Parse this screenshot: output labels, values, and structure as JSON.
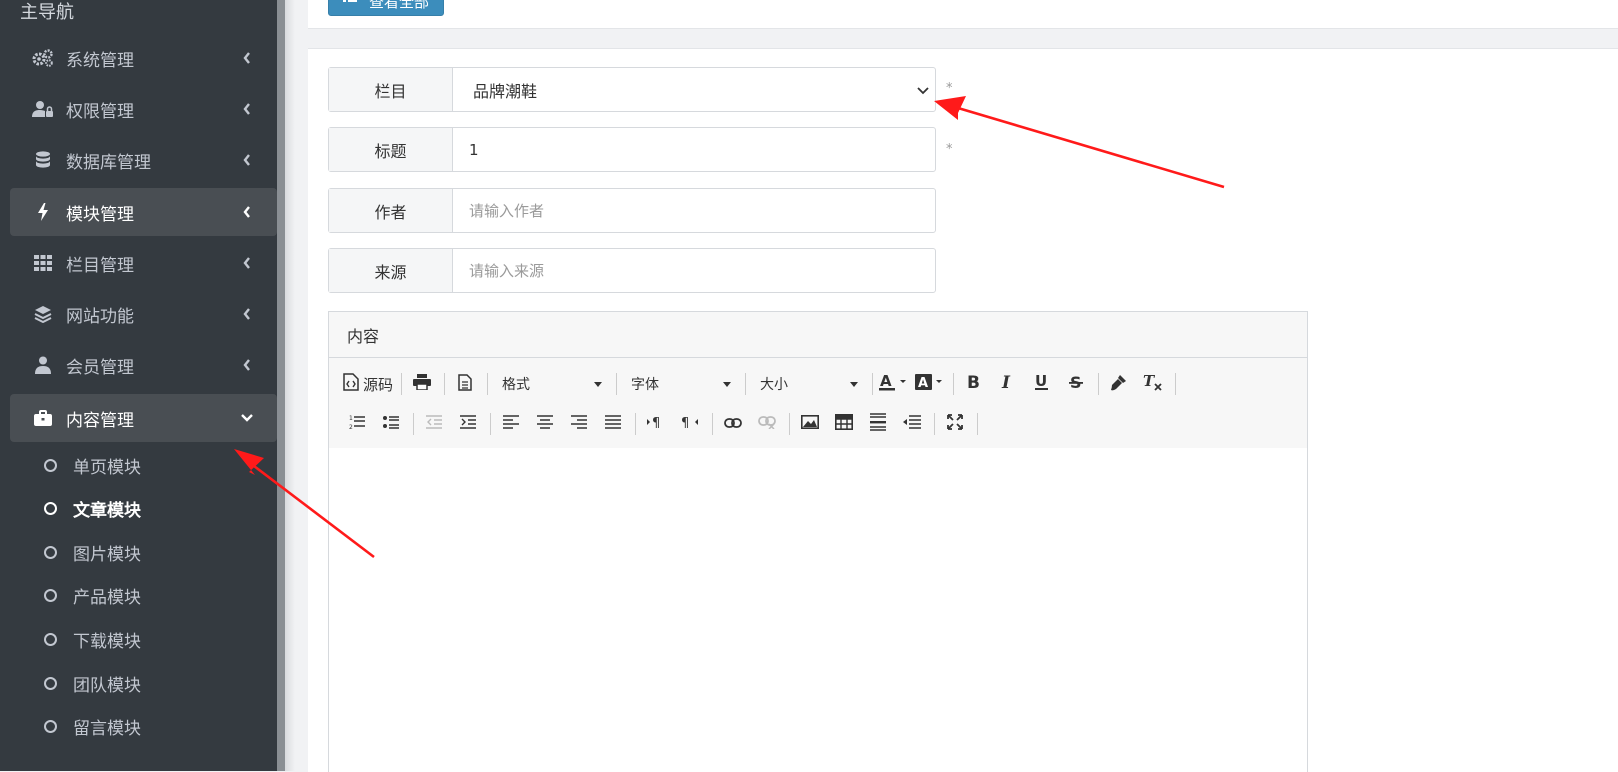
{
  "sidebar": {
    "header": "主导航",
    "items": [
      {
        "label": "系统管理",
        "icon": "gears-icon"
      },
      {
        "label": "权限管理",
        "icon": "user-lock-icon"
      },
      {
        "label": "数据库管理",
        "icon": "database-icon"
      },
      {
        "label": "模块管理",
        "icon": "bolt-icon"
      },
      {
        "label": "栏目管理",
        "icon": "grid-icon"
      },
      {
        "label": "网站功能",
        "icon": "layers-icon"
      },
      {
        "label": "会员管理",
        "icon": "user-icon"
      },
      {
        "label": "内容管理",
        "icon": "briefcase-icon"
      }
    ],
    "sub_items": [
      "单页模块",
      "文章模块",
      "图片模块",
      "产品模块",
      "下载模块",
      "团队模块",
      "留言模块"
    ]
  },
  "top_button": {
    "label": "查看全部"
  },
  "form": {
    "column": {
      "label": "栏目",
      "value": "品牌潮鞋"
    },
    "title": {
      "label": "标题",
      "value": "1"
    },
    "author": {
      "label": "作者",
      "placeholder": "请输入作者"
    },
    "source": {
      "label": "来源",
      "placeholder": "请输入来源"
    },
    "required_mark": "*"
  },
  "editor": {
    "label": "内容",
    "source_label": "源码",
    "format_label": "格式",
    "font_label": "字体",
    "size_label": "大小"
  },
  "colors": {
    "sidebar_bg": "#343a40",
    "accent": "#3c8dbc",
    "arrow": "#ff1a1a"
  }
}
